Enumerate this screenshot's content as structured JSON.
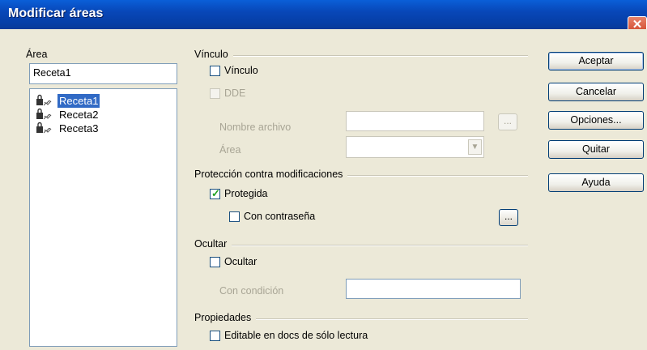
{
  "window": {
    "title": "Modificar áreas",
    "close_glyph": "✕"
  },
  "area_group": {
    "title": "Área",
    "name_value": "Receta1",
    "items": [
      {
        "label": "Receta1",
        "selected": true
      },
      {
        "label": "Receta2",
        "selected": false
      },
      {
        "label": "Receta3",
        "selected": false
      }
    ]
  },
  "link_group": {
    "title": "Vínculo",
    "link_checkbox": "Vínculo",
    "dde_checkbox": "DDE",
    "filename_label": "Nombre archivo",
    "filename_value": "",
    "area_label": "Área",
    "browse_glyph": "..."
  },
  "protection_group": {
    "title": "Protección contra modificaciones",
    "protected_checkbox": "Protegida",
    "password_checkbox": "Con contraseña",
    "password_button": "..."
  },
  "hide_group": {
    "title": "Ocultar",
    "hide_checkbox": "Ocultar",
    "condition_label": "Con condición",
    "condition_value": ""
  },
  "properties_group": {
    "title": "Propiedades",
    "readonly_checkbox": "Editable en docs de sólo lectura"
  },
  "buttons": {
    "accept": "Aceptar",
    "cancel": "Cancelar",
    "options": "Opciones...",
    "remove": "Quitar",
    "help": "Ayuda"
  },
  "state": {
    "link_checked": false,
    "dde_checked": false,
    "protected_checked": true,
    "password_checked": false,
    "hide_checked": false,
    "readonly_checked": false
  },
  "icons": [
    "close-icon",
    "lock-icon",
    "check-icon",
    "dropdown-arrow-icon"
  ]
}
